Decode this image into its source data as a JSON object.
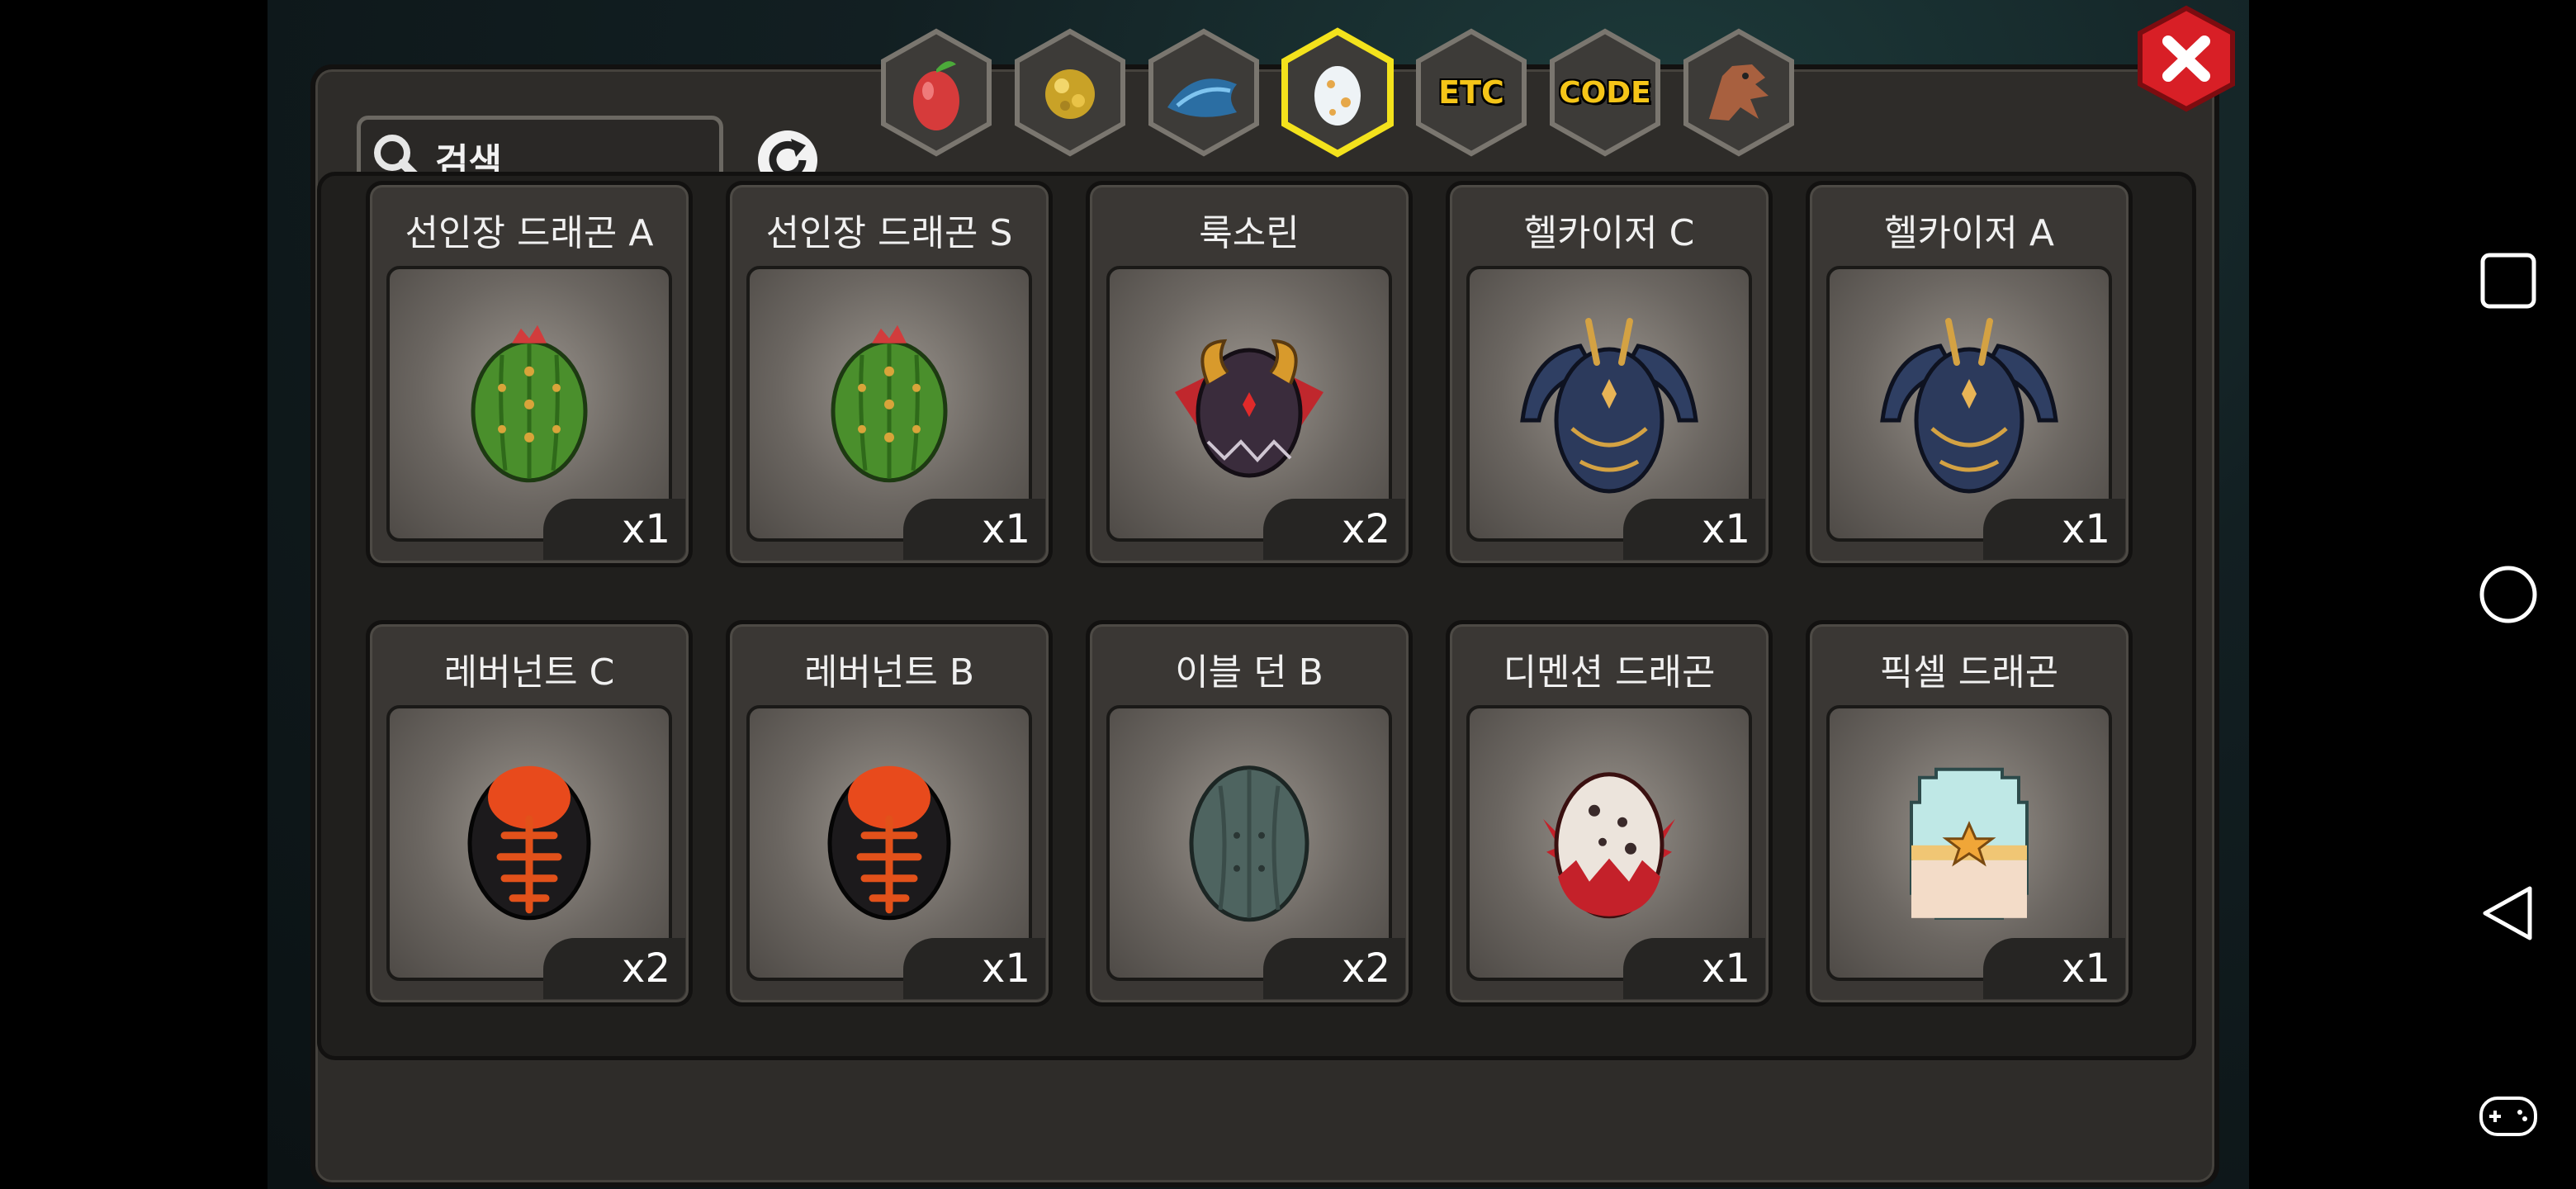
{
  "search": {
    "placeholder": "검색"
  },
  "tabs": [
    {
      "id": "fruit",
      "label": "",
      "icon": "fruit-icon",
      "active": false
    },
    {
      "id": "gold",
      "label": "",
      "icon": "gold-icon",
      "active": false
    },
    {
      "id": "fish",
      "label": "",
      "icon": "fish-icon",
      "active": false
    },
    {
      "id": "egg",
      "label": "",
      "icon": "egg-icon",
      "active": true
    },
    {
      "id": "etc",
      "label": "ETC",
      "icon": "",
      "active": false
    },
    {
      "id": "code",
      "label": "CODE",
      "icon": "",
      "active": false
    },
    {
      "id": "dragon",
      "label": "",
      "icon": "dragon-icon",
      "active": false
    }
  ],
  "items": [
    {
      "name": "선인장 드래곤 A",
      "count": "x1",
      "egg": "cactus"
    },
    {
      "name": "선인장 드래곤 S",
      "count": "x1",
      "egg": "cactus"
    },
    {
      "name": "룩소린",
      "count": "x2",
      "egg": "horned"
    },
    {
      "name": "헬카이저 C",
      "count": "x1",
      "egg": "hellkaiser"
    },
    {
      "name": "헬카이저 A",
      "count": "x1",
      "egg": "hellkaiser"
    },
    {
      "name": "레버넌트 C",
      "count": "x2",
      "egg": "revenant"
    },
    {
      "name": "레버넌트 B",
      "count": "x1",
      "egg": "revenant"
    },
    {
      "name": "이블 던 B",
      "count": "x2",
      "egg": "evil-dawn"
    },
    {
      "name": "디멘션 드래곤",
      "count": "x1",
      "egg": "dimension"
    },
    {
      "name": "픽셀 드래곤",
      "count": "x1",
      "egg": "pixel"
    }
  ],
  "colors": {
    "accent_active": "#f3e21c",
    "tab_label": "#f5c518",
    "close_red": "#d81f26"
  },
  "system_nav": [
    "recents-icon",
    "home-icon",
    "back-icon",
    "gamepad-icon"
  ]
}
